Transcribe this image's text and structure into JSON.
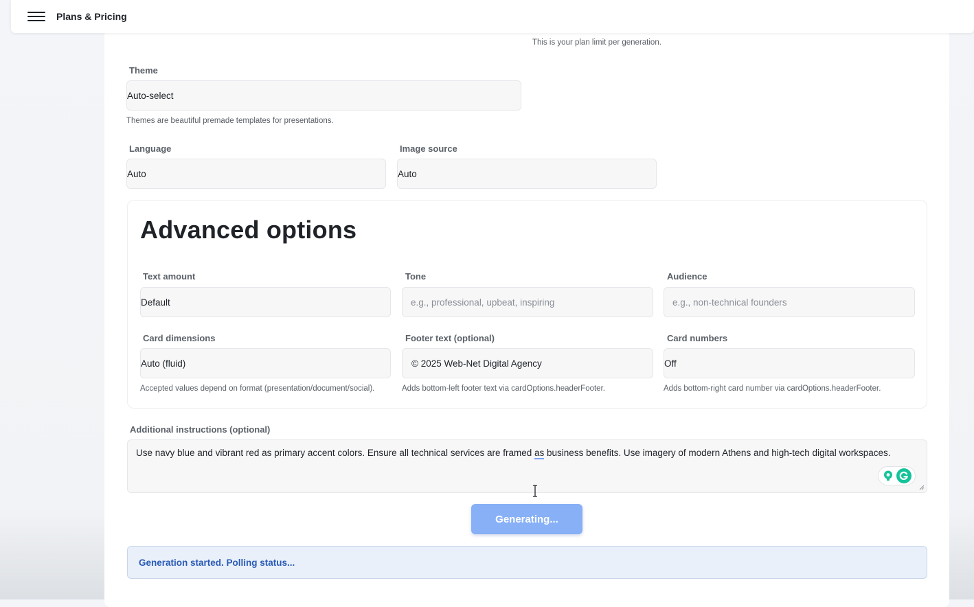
{
  "header": {
    "title": "Plans & Pricing"
  },
  "plan_hint": "This is your plan limit per generation.",
  "theme": {
    "label": "Theme",
    "value": "Auto-select",
    "hint": "Themes are beautiful premade templates for presentations."
  },
  "language": {
    "label": "Language",
    "value": "Auto"
  },
  "image_source": {
    "label": "Image source",
    "value": "Auto"
  },
  "advanced": {
    "title": "Advanced options",
    "text_amount": {
      "label": "Text amount",
      "value": "Default"
    },
    "tone": {
      "label": "Tone",
      "placeholder": "e.g., professional, upbeat, inspiring"
    },
    "audience": {
      "label": "Audience",
      "placeholder": "e.g., non-technical founders"
    },
    "card_dimensions": {
      "label": "Card dimensions",
      "value": "Auto (fluid)",
      "hint": "Accepted values depend on format (presentation/document/social)."
    },
    "footer_text": {
      "label": "Footer text (optional)",
      "value": "© 2025 Web-Net Digital Agency",
      "hint": "Adds bottom-left footer text via cardOptions.headerFooter."
    },
    "card_numbers": {
      "label": "Card numbers",
      "value": "Off",
      "hint": "Adds bottom-right card number via cardOptions.headerFooter."
    }
  },
  "instructions": {
    "label": "Additional instructions (optional)",
    "text_before": "Use navy blue and vibrant red as primary accent colors. Ensure all technical services are framed ",
    "text_underlined": "as",
    "text_after": " business benefits. Use imagery of modern Athens and high-tech digital workspaces."
  },
  "generate_button": "Generating...",
  "status_message": "Generation started. Polling status...",
  "colors": {
    "primary_button": "#87b0f6",
    "status_text": "#2a5bb5",
    "status_bg": "#e9f0fa",
    "grammarly": "#15c39a"
  },
  "icons": {
    "menu": "hamburger-menu-icon",
    "assistant": "lightbulb-icon",
    "grammarly": "grammarly-icon",
    "cursor": "text-cursor-icon"
  }
}
